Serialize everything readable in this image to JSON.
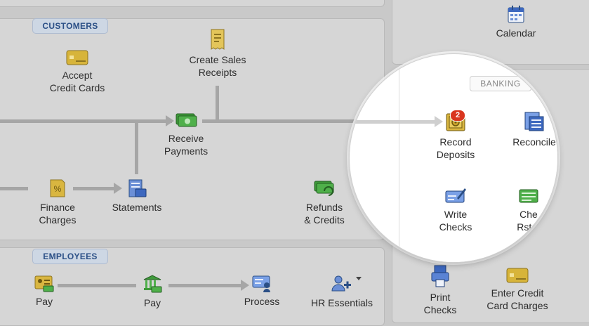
{
  "sections": {
    "customers_label": "CUSTOMERS",
    "employees_label": "EMPLOYEES",
    "banking_label": "BANKING"
  },
  "customers": {
    "accept_credit_cards": "Accept\nCredit Cards",
    "create_sales_receipts": "Create Sales\nReceipts",
    "receive_payments": "Receive\nPayments",
    "finance_charges": "Finance\nCharges",
    "statements": "Statements",
    "refunds_credits": "Refunds\n& Credits"
  },
  "employees": {
    "pay_1": "Pay",
    "pay_2": "Pay",
    "process": "Process",
    "hr_essentials": "HR Essentials"
  },
  "company": {
    "calendar": "Calendar"
  },
  "banking": {
    "record_deposits": "Record\nDeposits",
    "record_deposits_badge": "2",
    "reconcile": "Reconcile",
    "write_checks": "Write\nChecks",
    "check_register": "Check\nRegister",
    "check_register_visible": "Che\nRster",
    "print_checks": "Print\nChecks",
    "enter_credit_card_charges": "Enter Credit\nCard Charges"
  },
  "icons": {
    "accept_credit_cards": "credit-card-icon",
    "create_sales_receipts": "receipt-icon",
    "receive_payments": "cash-icon",
    "finance_charges": "finance-charges-icon",
    "statements": "statement-icon",
    "refunds_credits": "refund-icon",
    "calendar": "calendar-icon",
    "record_deposits": "safe-icon",
    "reconcile": "reconcile-icon",
    "write_checks": "write-check-icon",
    "check_register": "check-register-icon",
    "print_checks": "printer-icon",
    "enter_credit_card_charges": "credit-card-icon",
    "pay_1": "id-card-icon",
    "pay_2": "bank-icon",
    "process": "payroll-check-icon",
    "hr_essentials": "hr-icon"
  },
  "colors": {
    "background": "#c9c9c9",
    "panel": "#d6d6d6",
    "section_tab_text": "#2b4f86",
    "badge": "#d9361e",
    "flow_arrow": "#a6a6a6"
  }
}
